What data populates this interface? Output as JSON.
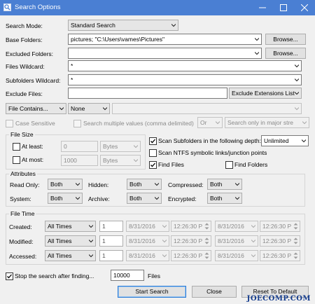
{
  "window": {
    "title": "Search Options",
    "controls": [
      "minimize-icon",
      "maximize-icon",
      "close-icon"
    ],
    "accent": "#4a7fd3"
  },
  "search_mode": {
    "label": "Search Mode:",
    "value": "Standard Search"
  },
  "base_folders": {
    "label": "Base Folders:",
    "value": "pictures; \"C:\\Users\\vames\\Pictures\"",
    "browse": "Browse..."
  },
  "excluded_folders": {
    "label": "Excluded Folders:",
    "value": "",
    "browse": "Browse..."
  },
  "files_wildcard": {
    "label": "Files Wildcard:",
    "value": "*"
  },
  "subfolders_wildcard": {
    "label": "Subfolders Wildcard:",
    "value": "*"
  },
  "exclude_files": {
    "label": "Exclude Files:",
    "value": "",
    "list": "Exclude Extensions List"
  },
  "contains": {
    "mode": "File Contains...",
    "encoding": "None",
    "text": ""
  },
  "case_sensitive": {
    "label": "Case Sensitive",
    "checked": false
  },
  "multiple_values": {
    "label": "Search multiple values (comma delimited)",
    "checked": false,
    "op": "Or",
    "scope": "Search only in major stre"
  },
  "file_size": {
    "title": "File Size",
    "at_least": {
      "label": "At least:",
      "checked": false,
      "value": "0",
      "unit": "Bytes"
    },
    "at_most": {
      "label": "At most:",
      "checked": false,
      "value": "1000",
      "unit": "Bytes"
    }
  },
  "depth": {
    "label": "Scan Subfolders in the following depth:",
    "checked": true,
    "value": "Unlimited"
  },
  "ntfs_links": {
    "label": "Scan NTFS symbolic links/junction points",
    "checked": false
  },
  "find_files": {
    "label": "Find Files",
    "checked": true
  },
  "find_folders": {
    "label": "Find Folders",
    "checked": false
  },
  "attributes": {
    "title": "Attributes",
    "read_only": {
      "label": "Read Only:",
      "value": "Both"
    },
    "system": {
      "label": "System:",
      "value": "Both"
    },
    "hidden": {
      "label": "Hidden:",
      "value": "Both"
    },
    "archive": {
      "label": "Archive:",
      "value": "Both"
    },
    "compressed": {
      "label": "Compressed:",
      "value": "Both"
    },
    "encrypted": {
      "label": "Encrypted:",
      "value": "Both"
    }
  },
  "file_time": {
    "title": "File Time",
    "rows": [
      {
        "label": "Created:",
        "mode": "All Times",
        "count": "1",
        "date1": "8/31/2016",
        "time1": "12:26:30 P",
        "date2": "8/31/2016",
        "time2": "12:26:30 P"
      },
      {
        "label": "Modified:",
        "mode": "All Times",
        "count": "1",
        "date1": "8/31/2016",
        "time1": "12:26:30 P",
        "date2": "8/31/2016",
        "time2": "12:26:30 P"
      },
      {
        "label": "Accessed:",
        "mode": "All Times",
        "count": "1",
        "date1": "8/31/2016",
        "time1": "12:26:30 P",
        "date2": "8/31/2016",
        "time2": "12:26:30 P"
      }
    ]
  },
  "stop_after": {
    "label": "Stop the search after finding...",
    "checked": true,
    "value": "10000",
    "unit": "Files"
  },
  "buttons": {
    "start": "Start Search",
    "close": "Close",
    "reset": "Reset To Default"
  },
  "watermark": "JOECOMP.COM"
}
